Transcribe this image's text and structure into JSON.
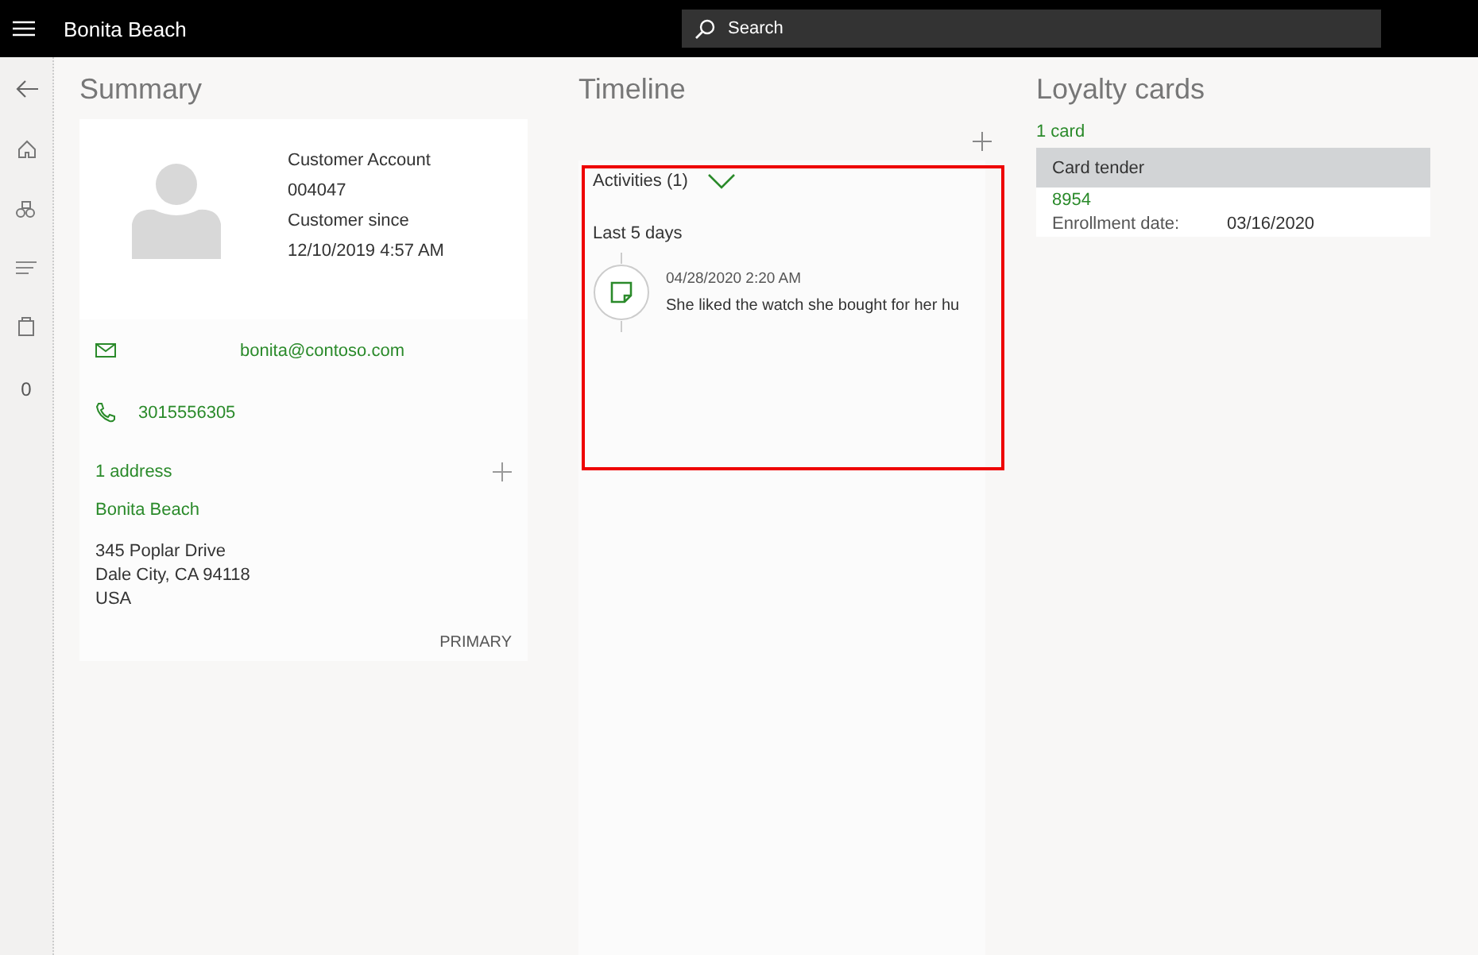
{
  "header": {
    "title": "Bonita Beach",
    "search": {
      "placeholder": "Search"
    }
  },
  "rail": {
    "badge": "0"
  },
  "summary": {
    "title": "Summary",
    "account_label": "Customer Account",
    "account": "004047",
    "since_label": "Customer since",
    "since": "12/10/2019 4:57 AM",
    "email": "bonita@contoso.com",
    "phone": "3015556305",
    "address_count": "1 address",
    "address": {
      "name": "Bonita Beach",
      "lines": [
        "345 Poplar Drive",
        "Dale City, CA 94118",
        "USA"
      ],
      "tag": "PRIMARY"
    }
  },
  "timeline": {
    "title": "Timeline",
    "activities": {
      "label": "Activities (1)",
      "expanded": true,
      "highlighted": true,
      "period": "Last 5 days",
      "items": [
        {
          "time": "04/28/2020 2:20 AM",
          "text": "She liked the watch she bought for her hu"
        }
      ]
    }
  },
  "loyalty": {
    "title": "Loyalty cards",
    "count": "1 card",
    "card": {
      "tender": "Card tender",
      "number": "8954",
      "label": "Enrollment date:",
      "date": "03/16/2020"
    }
  }
}
